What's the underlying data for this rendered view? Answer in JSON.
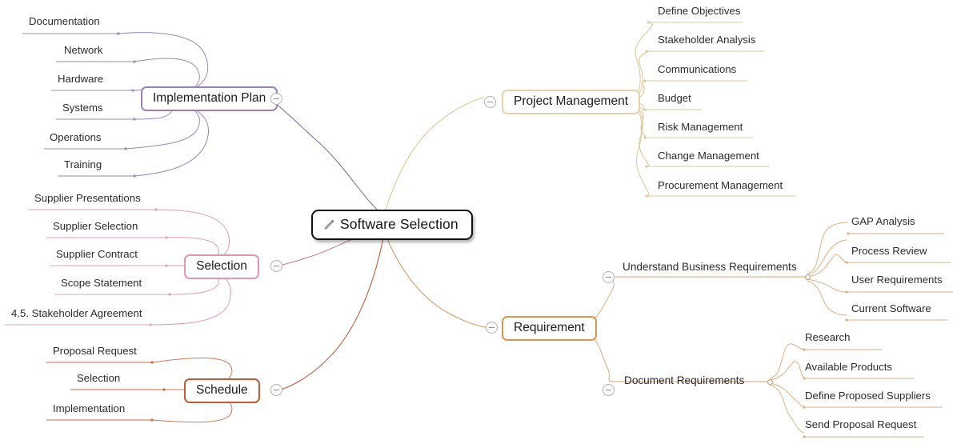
{
  "map": {
    "root": {
      "label": "Software Selection",
      "icon": "pencil-icon"
    },
    "colors": {
      "implementation_plan": "#8B6FA8",
      "project_management": "#E0CFA0",
      "selection": "#D98AA0",
      "requirement": "#D99A63",
      "schedule": "#C4572B",
      "root_border": "#121212",
      "toggle_border": "#B0B0B0",
      "text": "#2B2B2B"
    },
    "branches": [
      {
        "id": "implementation-plan",
        "label": "Implementation Plan",
        "side": "left",
        "color": "#8B6FA8",
        "border": "#9B7FB8",
        "collapsed": false,
        "children": [
          {
            "label": "Documentation"
          },
          {
            "label": "Network"
          },
          {
            "label": "Hardware"
          },
          {
            "label": "Systems"
          },
          {
            "label": "Operations"
          },
          {
            "label": "Training"
          }
        ]
      },
      {
        "id": "selection",
        "label": "Selection",
        "side": "left",
        "color": "#D98AA0",
        "border": "#DE97AB",
        "collapsed": false,
        "children": [
          {
            "label": "Supplier Presentations"
          },
          {
            "label": "Supplier Selection"
          },
          {
            "label": "Supplier Contract"
          },
          {
            "label": "Scope Statement"
          },
          {
            "label": "4.5. Stakeholder Agreement"
          }
        ]
      },
      {
        "id": "schedule",
        "label": "Schedule",
        "side": "left",
        "color": "#C4572B",
        "border": "#C05A30",
        "collapsed": false,
        "children": [
          {
            "label": "Proposal Request"
          },
          {
            "label": "Selection"
          },
          {
            "label": "Implementation"
          }
        ]
      },
      {
        "id": "project-management",
        "label": "Project Management",
        "side": "right",
        "color": "#DFCC9B",
        "border": "#E3D3A8",
        "collapsed": false,
        "children": [
          {
            "label": "Define Objectives"
          },
          {
            "label": "Stakeholder Analysis"
          },
          {
            "label": "Communications"
          },
          {
            "label": "Budget"
          },
          {
            "label": "Risk Management"
          },
          {
            "label": "Change Management"
          },
          {
            "label": "Procurement Management"
          }
        ]
      },
      {
        "id": "requirement",
        "label": "Requirement",
        "side": "right",
        "color": "#D99A63",
        "border": "#D9964F",
        "collapsed": false,
        "children": [
          {
            "label": "Understand Business Requirements",
            "children": [
              {
                "label": "GAP Analysis"
              },
              {
                "label": "Process Review"
              },
              {
                "label": "User Requirements"
              },
              {
                "label": "Current Software"
              }
            ]
          },
          {
            "label": "Document Requirements",
            "children": [
              {
                "label": "Research"
              },
              {
                "label": "Available Products"
              },
              {
                "label": "Define Proposed Suppliers"
              },
              {
                "label": "Send Proposal Request"
              }
            ]
          }
        ]
      }
    ],
    "toggles": {
      "minus_sign": "−"
    }
  }
}
